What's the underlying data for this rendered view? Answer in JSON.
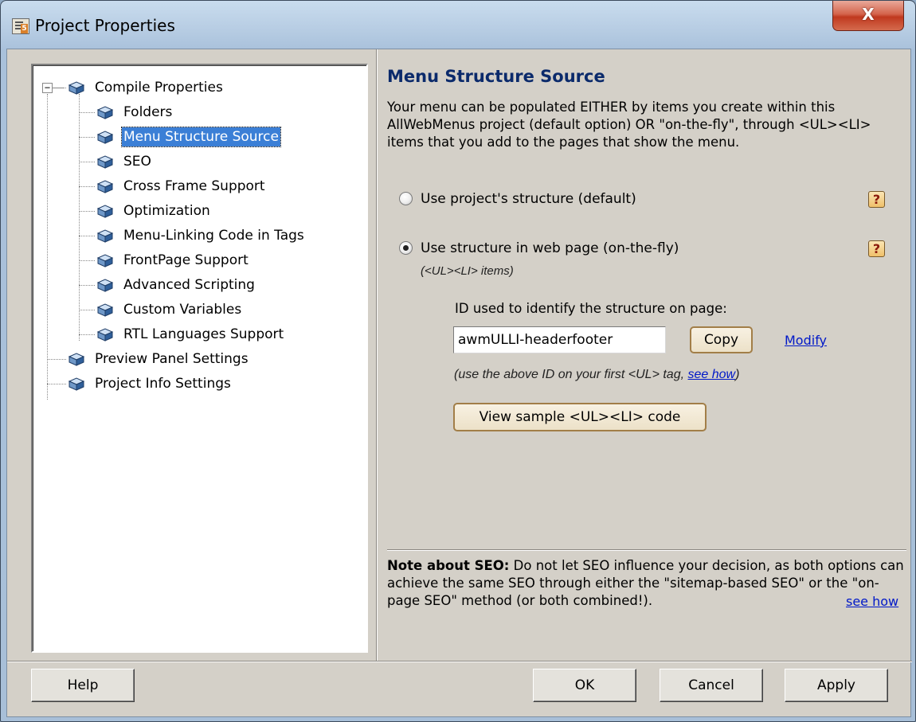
{
  "window": {
    "title": "Project Properties",
    "app_icon_number": "5",
    "close_glyph": "X"
  },
  "tree": {
    "root": "Compile Properties",
    "children": [
      "Folders",
      "Menu Structure Source",
      "SEO",
      "Cross Frame Support",
      "Optimization",
      "Menu-Linking Code in Tags",
      "FrontPage Support",
      "Advanced Scripting",
      "Custom Variables",
      "RTL Languages Support"
    ],
    "siblings": [
      "Preview Panel Settings",
      "Project Info Settings"
    ],
    "selected": "Menu Structure Source",
    "expander_glyph": "−",
    "item_icon": "cube-icon"
  },
  "panel": {
    "title": "Menu Structure Source",
    "description": "Your menu can be populated EITHER by items you create within this AllWebMenus project (default option) OR \"on-the-fly\", through <UL><LI> items that you add to the pages that show the menu.",
    "option1_label": "Use project's structure (default)",
    "option2_label": "Use structure in web page (on-the-fly)",
    "option2_sublabel": "(<UL><LI> items)",
    "selected_option": 2,
    "help_glyph": "?",
    "id_label": "ID used to identify the structure on page:",
    "id_value": "awmULLI-headerfooter",
    "copy_label": "Copy",
    "modify_label": "Modify",
    "id_note_prefix": "(use the above ID on your first <UL> tag, ",
    "id_note_link": "see how",
    "id_note_suffix": ")",
    "view_sample_label": "View sample <UL><LI> code",
    "note_bold": "Note about SEO:",
    "note_text": " Do not let SEO influence your decision, as both options can achieve the same SEO through either the \"sitemap-based SEO\" or the \"on-page SEO\" method (or both combined!).",
    "note_link": "see how"
  },
  "buttons": {
    "help": "Help",
    "ok": "OK",
    "cancel": "Cancel",
    "apply": "Apply"
  },
  "colors": {
    "title_blue": "#0b2a6b",
    "selection": "#3b7fd6",
    "link": "#0018c8",
    "help_red": "#8b1a0c"
  }
}
